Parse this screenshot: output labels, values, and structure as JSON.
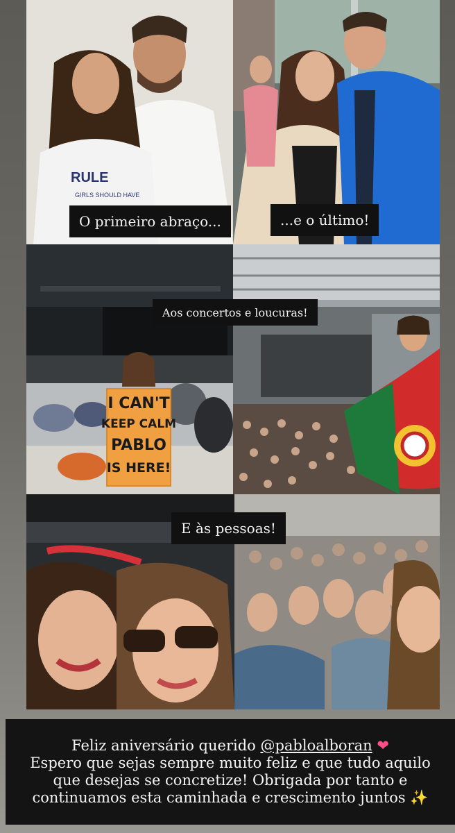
{
  "labels": {
    "first_hug": "O primeiro abraço...",
    "last": "...e o último!",
    "concerts": "Aos concertos e loucuras!",
    "people": "E às pessoas!"
  },
  "sign": {
    "line1": "I CAN'T",
    "line2": "KEEP CALM",
    "line3": "PABLO",
    "line4": "IS HERE!"
  },
  "caption": {
    "line1_prefix": "Feliz aniversário querido ",
    "mention": "@pabloalboran",
    "heart": "❤",
    "line2": "Espero que sejas sempre muito feliz e que tudo aquilo",
    "line3": "que desejas se concretize! Obrigada por tanto e",
    "line4_prefix": "continuamos esta caminhada e crescimento juntos ",
    "sparkle": "✨"
  },
  "colors": {
    "background": "#6a6963",
    "tag_bg": "#111111",
    "caption_bg": "#141414",
    "heart": "#ff4d8a",
    "sign": "#f0a040"
  }
}
